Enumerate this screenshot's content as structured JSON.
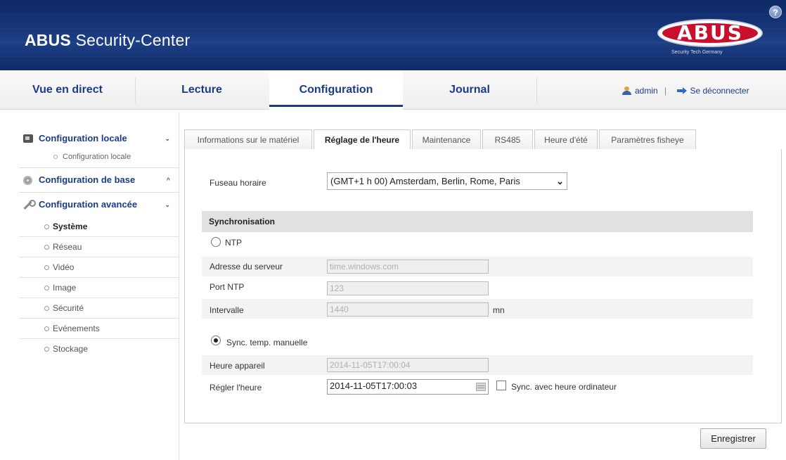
{
  "header": {
    "brand_bold": "ABUS",
    "brand_rest": " Security-Center",
    "logo_text": "ABUS",
    "logo_tagline": "Security Tech Germany",
    "help_label": "?"
  },
  "topnav": {
    "tabs": [
      {
        "label": "Vue en direct"
      },
      {
        "label": "Lecture"
      },
      {
        "label": "Configuration"
      },
      {
        "label": "Journal"
      }
    ],
    "active_tab": "Configuration",
    "user": "admin",
    "separator": "|",
    "logout": "Se déconnecter"
  },
  "sidebar": {
    "local": {
      "label": "Configuration locale",
      "chevron": "⌄",
      "sub": "Configuration locale"
    },
    "base": {
      "label": "Configuration de base",
      "chevron": "^"
    },
    "advanced": {
      "label": "Configuration avancée",
      "chevron": "⌄",
      "items": [
        "Système",
        "Réseau",
        "Vidéo",
        "Image",
        "Sécurité",
        "Evénements",
        "Stockage"
      ],
      "active": "Système"
    }
  },
  "subtabs": {
    "items": [
      "Informations sur le matériel",
      "Réglage de l'heure",
      "Maintenance",
      "RS485",
      "Heure d'été",
      "Paramètres fisheye"
    ],
    "active": "Réglage de l'heure"
  },
  "form": {
    "timezone_label": "Fuseau horaire",
    "timezone_value": "(GMT+1 h 00) Amsterdam, Berlin, Rome, Paris",
    "sync_section": "Synchronisation",
    "ntp_label": "NTP",
    "ntp_checked": false,
    "server_label": "Adresse du serveur",
    "server_value": "time.windows.com",
    "port_label": "Port NTP",
    "port_value": "123",
    "interval_label": "Intervalle",
    "interval_value": "1440",
    "interval_unit": "mn",
    "manual_label": "Sync. temp. manuelle",
    "manual_checked": true,
    "device_time_label": "Heure appareil",
    "device_time_value": "2014-11-05T17:00:04",
    "set_time_label": "Régler l'heure",
    "set_time_value": "2014-11-05T17:00:03",
    "sync_pc_label": "Sync. avec heure ordinateur",
    "sync_pc_checked": false
  },
  "actions": {
    "save_label": "Enregistrer"
  }
}
